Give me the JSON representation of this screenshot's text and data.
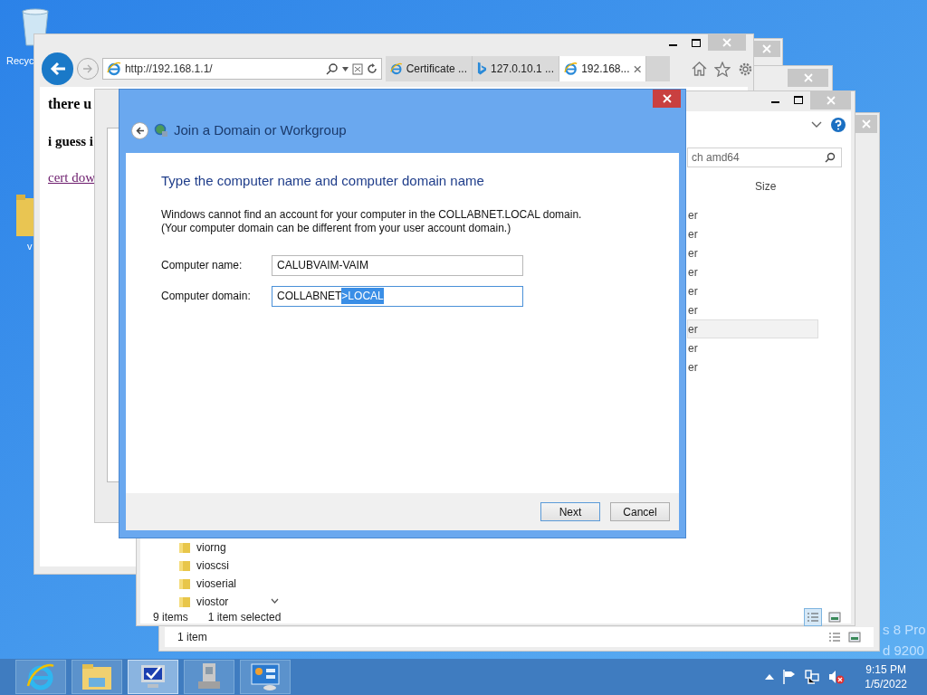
{
  "desktop": {
    "icon_labels": [
      "Recyc",
      "v"
    ],
    "watermark_lines": [
      "s 8 Pro",
      "d 9200"
    ]
  },
  "browser": {
    "address": "http://192.168.1.1/",
    "tabs": [
      {
        "label": "Certificate ...",
        "selected": false,
        "kind": "ie"
      },
      {
        "label": "127.0.10.1 ...",
        "selected": false,
        "kind": "bing"
      },
      {
        "label": "192.168...",
        "selected": true,
        "kind": "ie"
      }
    ],
    "page": {
      "heading": "there u",
      "subheading": "i guess i",
      "link": "cert dow"
    }
  },
  "explorer": {
    "search_placeholder": "ch amd64",
    "column_header": "Size",
    "rows": [
      {
        "text": "er",
        "selected": false
      },
      {
        "text": "er",
        "selected": false
      },
      {
        "text": "er",
        "selected": false
      },
      {
        "text": "er",
        "selected": false
      },
      {
        "text": "er",
        "selected": false
      },
      {
        "text": "er",
        "selected": false
      },
      {
        "text": "er",
        "selected": true
      },
      {
        "text": "er",
        "selected": false
      },
      {
        "text": "er",
        "selected": false
      }
    ],
    "folders": [
      "viorng",
      "vioscsi",
      "vioserial",
      "viostor"
    ],
    "status": [
      "9 items",
      "1 item selected"
    ],
    "views": [
      {
        "kind": "details",
        "selected": true
      },
      {
        "kind": "thumbnails",
        "selected": false
      }
    ]
  },
  "back_explorer": {
    "status": "1 item"
  },
  "dialog": {
    "title": "Join a Domain or Workgroup",
    "heading": "Type the computer name and computer domain name",
    "message_lines": [
      "Windows cannot find an account for your computer in the COLLABNET.LOCAL domain.",
      "(Your computer domain can be different from your user account domain.)"
    ],
    "fields": [
      {
        "label": "Computer name:",
        "value": "CALUBVAIM-VAIM",
        "focused": false
      },
      {
        "label": "Computer domain:",
        "value": "COLLABNET",
        "selected_text": ">LOCAL",
        "focused": true
      }
    ],
    "buttons": [
      {
        "label": "Next",
        "default": true
      },
      {
        "label": "Cancel",
        "default": false
      }
    ]
  },
  "taskbar": {
    "apps": [
      {
        "kind": "ie",
        "selected": false
      },
      {
        "kind": "explorer",
        "selected": false
      },
      {
        "kind": "monitor",
        "selected": true
      },
      {
        "kind": "server",
        "selected": false
      },
      {
        "kind": "panel",
        "selected": false
      }
    ],
    "time": "9:15 PM",
    "date": "1/5/2022"
  }
}
